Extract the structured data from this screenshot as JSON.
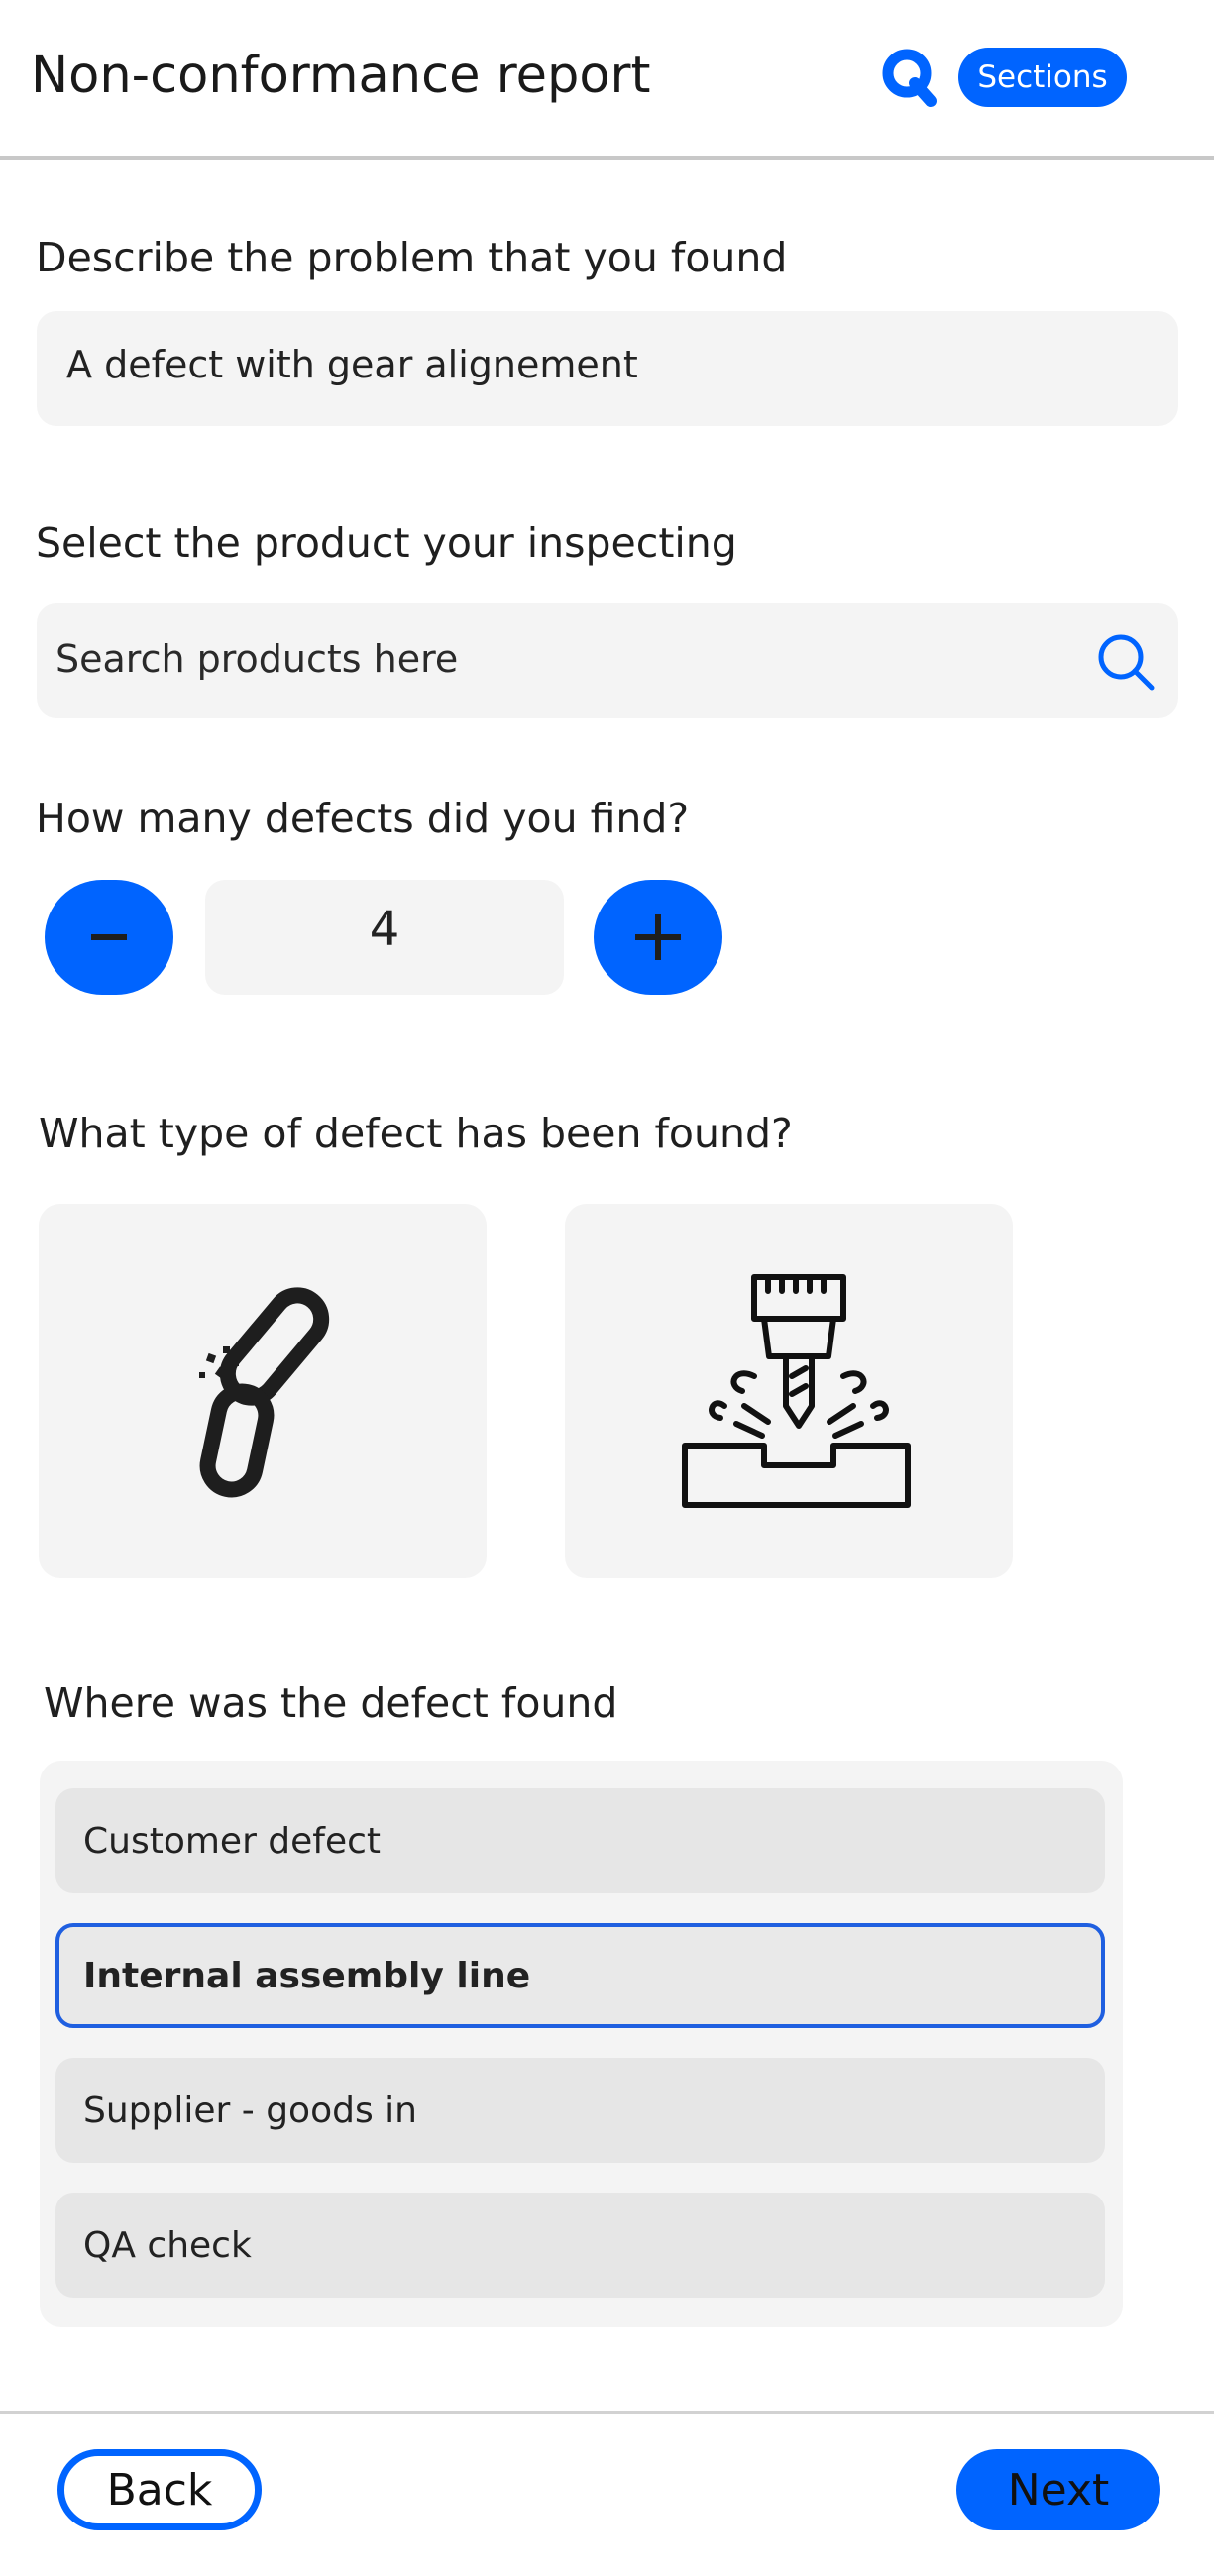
{
  "header": {
    "title": "Non-conformance report",
    "sections_label": "Sections",
    "logo_icon": "q-logo-icon"
  },
  "colors": {
    "accent": "#0064ff",
    "field_bg": "#f4f4f4",
    "option_bg": "#e6e6e6",
    "selected_border": "#1f5fe0"
  },
  "problem": {
    "label": "Describe the problem that you found",
    "value": "A defect with gear alignement"
  },
  "product": {
    "label": "Select the product your inspecting",
    "placeholder": "Search products here",
    "icon": "search-icon"
  },
  "defect_count": {
    "label": "How many defects did you find?",
    "value": "4",
    "decrement_icon": "minus-icon",
    "increment_icon": "plus-icon"
  },
  "defect_type": {
    "label": "What type of defect has been found?",
    "options": [
      {
        "icon": "broken-chain-icon"
      },
      {
        "icon": "drilling-machine-icon"
      }
    ]
  },
  "location": {
    "label": "Where was the defect found",
    "options": [
      {
        "label": "Customer defect",
        "selected": false
      },
      {
        "label": "Internal assembly line",
        "selected": true
      },
      {
        "label": "Supplier - goods in",
        "selected": false
      },
      {
        "label": "QA check",
        "selected": false
      }
    ]
  },
  "footer": {
    "back_label": "Back",
    "next_label": "Next"
  }
}
